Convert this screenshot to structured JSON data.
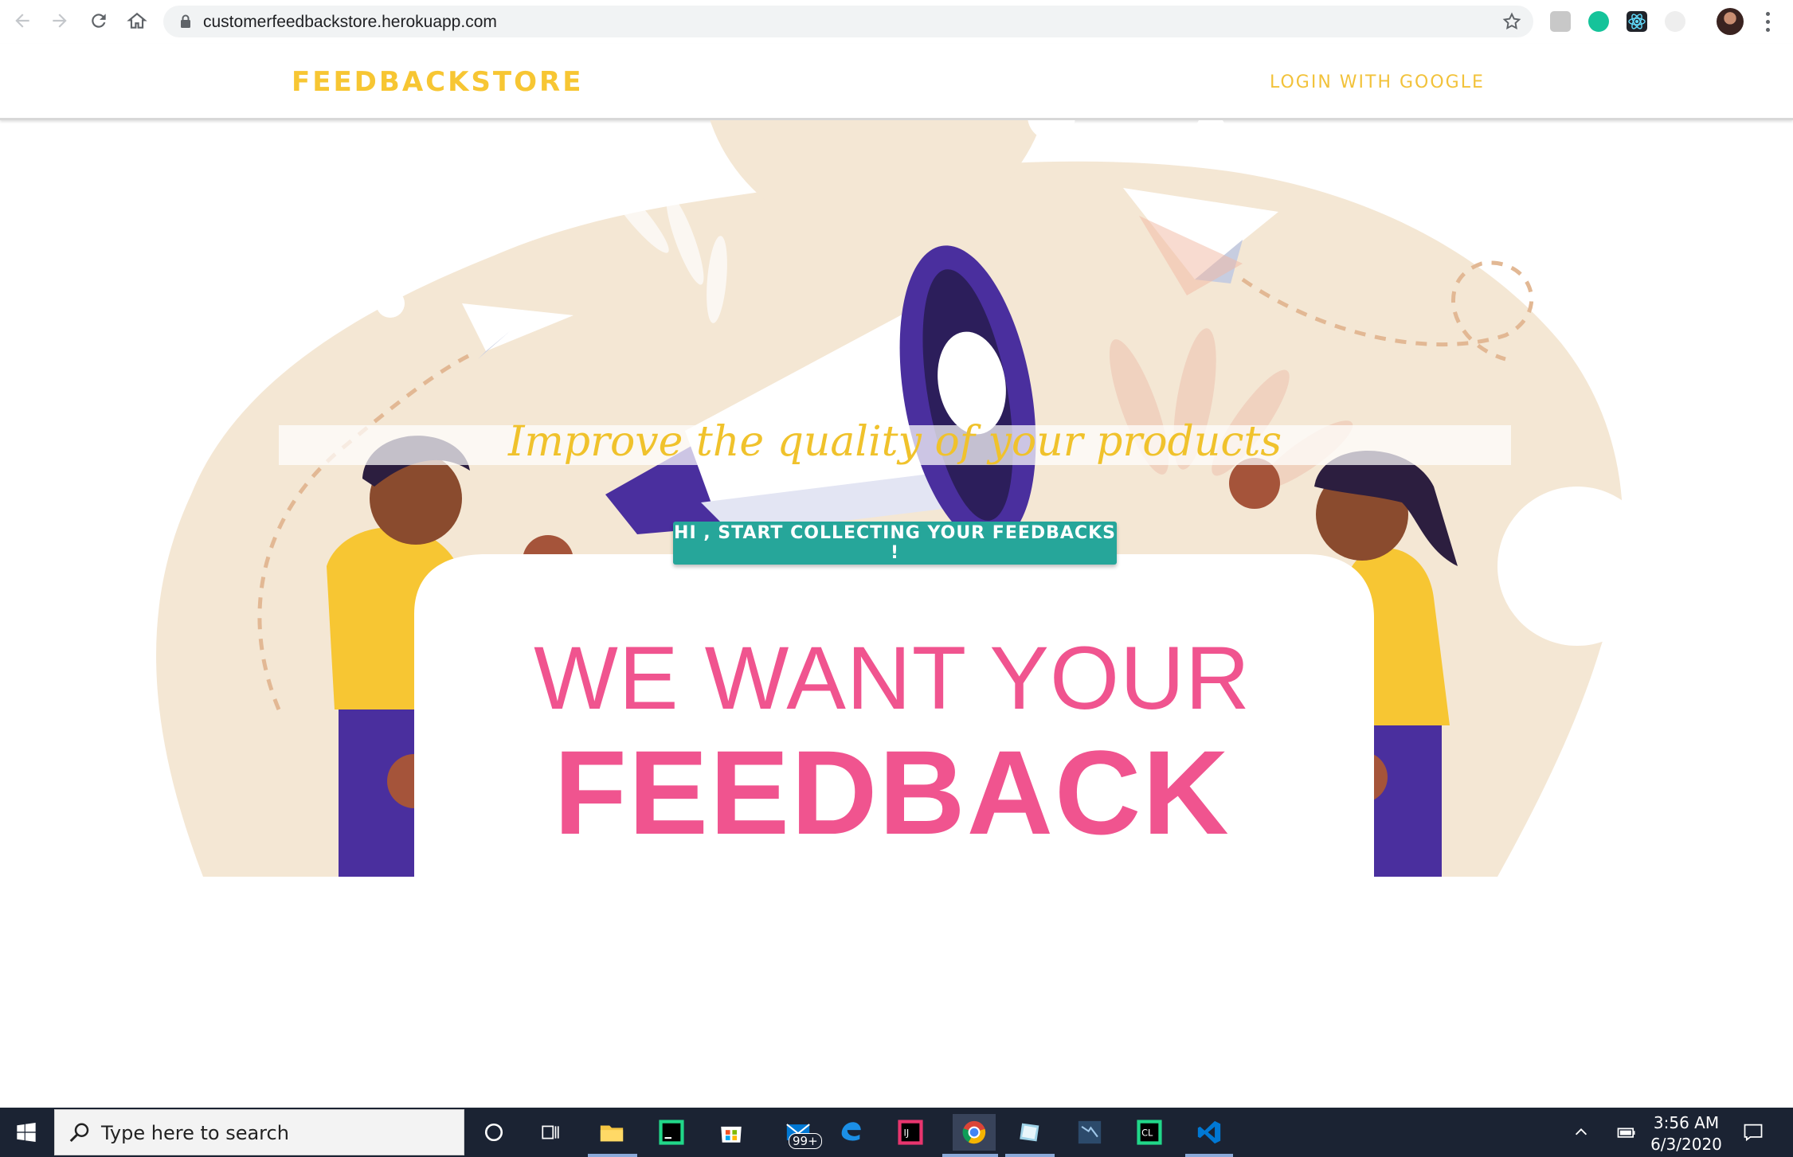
{
  "browser": {
    "url": "customerfeedbackstore.herokuapp.com",
    "icons": [
      "back-arrow-icon",
      "forward-arrow-icon",
      "reload-icon",
      "home-icon",
      "lock-icon",
      "star-icon"
    ]
  },
  "navbar": {
    "brand": "FEEDBACKSTORE",
    "login_label": "LOGIN WITH GOOGLE",
    "accent_color": "#f7c633"
  },
  "hero": {
    "tagline": "Improve the quality of your products",
    "cta_label": "HI , START COLLECTING YOUR FEEDBACKS !",
    "cta_color": "#26a69a",
    "sign_line1": "WE WANT YOUR",
    "sign_line2": "FEEDBACK",
    "sign_color": "#f0548f"
  },
  "taskbar": {
    "search_placeholder": "Type here to search",
    "mail_badge": "99+",
    "time": "3:56 AM",
    "date": "6/3/2020"
  }
}
